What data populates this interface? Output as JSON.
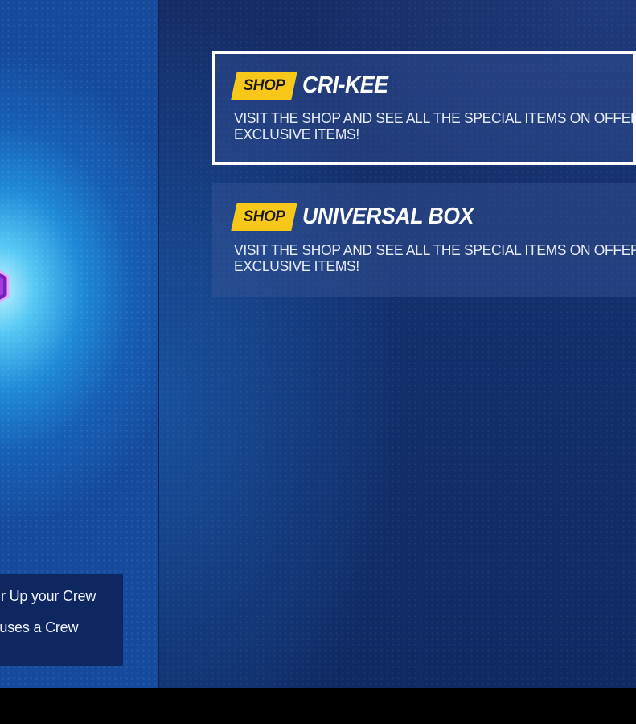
{
  "crew_panel": {
    "line1": "r Up your Crew",
    "line2": "bonuses a Crew"
  },
  "offers": [
    {
      "tag": "SHOP",
      "title": "CRI-KEE",
      "desc_line1": "VISIT THE SHOP AND SEE ALL THE SPECIAL ITEMS ON OFFER",
      "desc_line2": "EXCLUSIVE ITEMS!",
      "selected": true
    },
    {
      "tag": "SHOP",
      "title": "UNIVERSAL BOX",
      "desc_line1": "VISIT THE SHOP AND SEE ALL THE SPECIAL ITEMS ON OFFER",
      "desc_line2": "EXCLUSIVE ITEMS!",
      "selected": false
    }
  ],
  "colors": {
    "tag_yellow": "#f7c81a",
    "panel_blue": "#13306e",
    "glow_cyan": "#55c8f4",
    "gem_purple": "#a23de0"
  }
}
